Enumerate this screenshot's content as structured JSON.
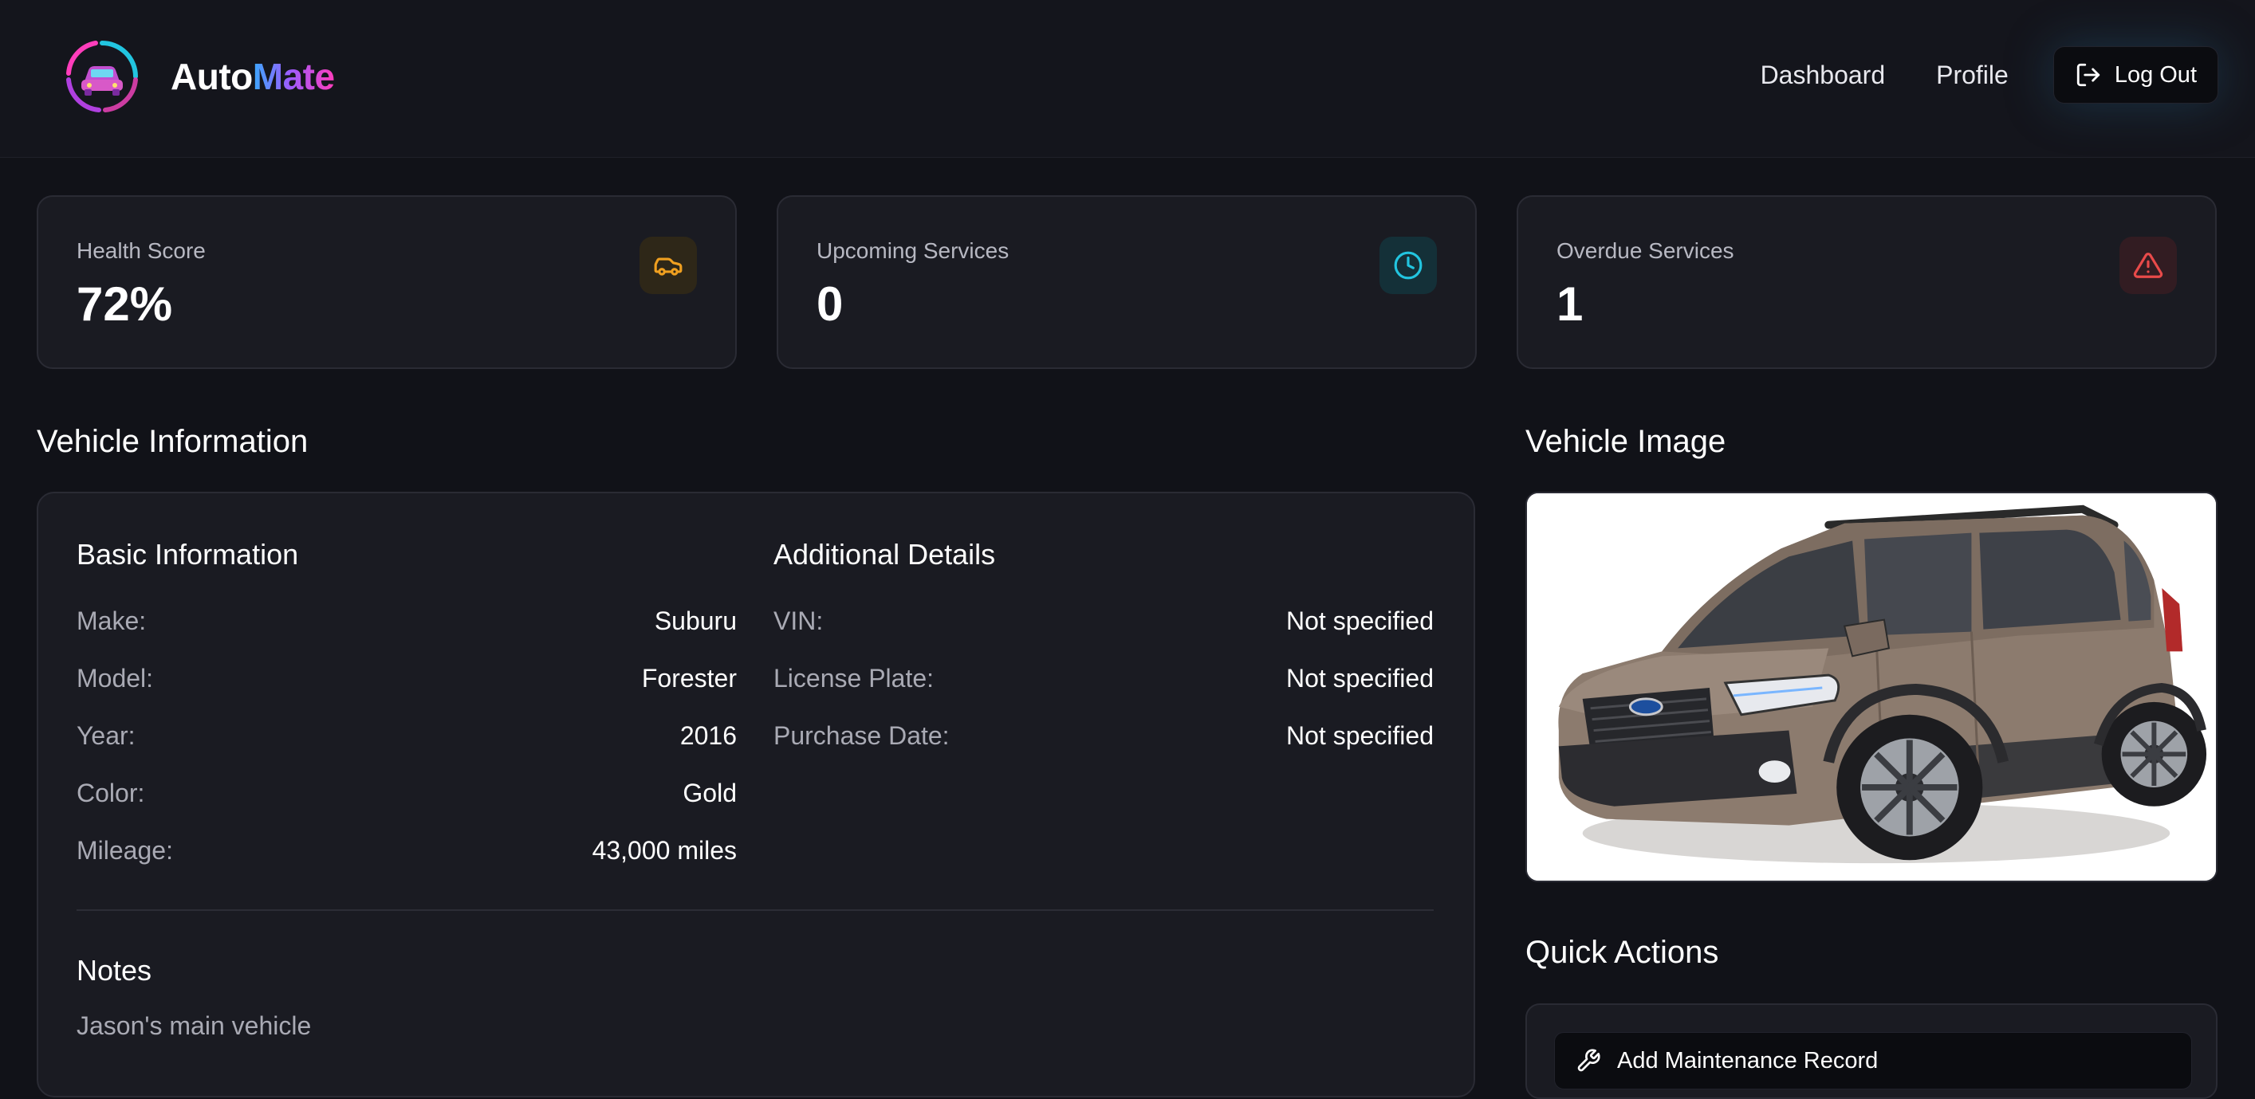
{
  "app": {
    "brand_part1": "Auto",
    "brand_part2": "Mate",
    "logo_icon": "car-gauge-logo-icon"
  },
  "nav": {
    "dashboard": "Dashboard",
    "profile": "Profile",
    "logout": "Log Out",
    "logout_icon": "log-out-icon"
  },
  "stats": [
    {
      "label": "Health Score",
      "value": "72%",
      "icon": "car-icon",
      "color": "#f0a020"
    },
    {
      "label": "Upcoming Services",
      "value": "0",
      "icon": "clock-icon",
      "color": "#22c5e0"
    },
    {
      "label": "Overdue Services",
      "value": "1",
      "icon": "alert-triangle-icon",
      "color": "#e84a4a"
    }
  ],
  "vehicle_info": {
    "title": "Vehicle Information",
    "basic": {
      "title": "Basic Information",
      "rows": [
        {
          "label": "Make:",
          "value": "Suburu"
        },
        {
          "label": "Model:",
          "value": "Forester"
        },
        {
          "label": "Year:",
          "value": "2016"
        },
        {
          "label": "Color:",
          "value": "Gold"
        },
        {
          "label": "Mileage:",
          "value": "43,000 miles"
        }
      ]
    },
    "additional": {
      "title": "Additional Details",
      "rows": [
        {
          "label": "VIN:",
          "value": "Not specified"
        },
        {
          "label": "License Plate:",
          "value": "Not specified"
        },
        {
          "label": "Purchase Date:",
          "value": "Not specified"
        }
      ]
    },
    "notes": {
      "title": "Notes",
      "text": "Jason's main vehicle"
    }
  },
  "vehicle_image": {
    "title": "Vehicle Image"
  },
  "quick_actions": {
    "title": "Quick Actions",
    "add_maintenance": "Add Maintenance Record",
    "add_maintenance_icon": "wrench-icon"
  }
}
